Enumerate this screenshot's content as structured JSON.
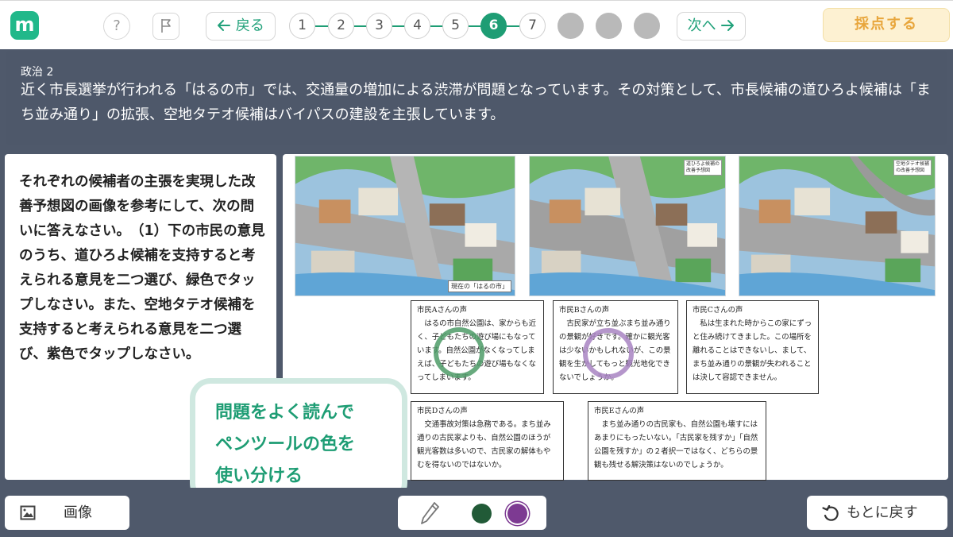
{
  "app": {
    "logo_letter": "m"
  },
  "toolbar": {
    "help_symbol": "?",
    "back_label": "戻る",
    "next_label": "次へ",
    "grade_label": "採点する",
    "steps": [
      "1",
      "2",
      "3",
      "4",
      "5",
      "6",
      "7",
      "",
      "",
      ""
    ],
    "current_step": "6"
  },
  "question": {
    "label": "政治 2",
    "text": "近く市長選挙が行われる「はるの市」では、交通量の増加による渋滞が問題となっています。その対策として、市長候補の道ひろよ候補は「まち並み通り」の拡張、空地タテオ候補はバイパスの建設を主張しています。"
  },
  "instructions": {
    "text": "それぞれの候補者の主張を実現した改善予想図の画像を参考にして、次の問いに答えなさい。　（1）下の市民の意見のうち、道ひろよ候補を支持すると考えられる意見を二つ選び、緑色でタップしなさい。また、空地タテオ候補を支持すると考えられる意見を二つ選び、紫色でタップしなさい。"
  },
  "images": {
    "current_caption": "現在の「はるの市」",
    "michi_badge": "道ひろよ候補の改善予想図",
    "sorachi_badge": "空地タテオ候補の改善予想図"
  },
  "opinions": [
    {
      "title": "市民Aさんの声",
      "body": "はるの市自然公園は、家からも近く、子どもたちの遊び場にもなっています。自然公園がなくなってしまえば、子どもたちの遊び場もなくなってしまいます。"
    },
    {
      "title": "市民Bさんの声",
      "body": "古民家が立ち並ぶまち並み通りの景観が好きです。確かに観光客は少ないかもしれないが、この景観を生かしてもっと観光地化できないでしょうか。"
    },
    {
      "title": "市民Cさんの声",
      "body": "私は生まれた時からこの家にずっと住み続けてきました。この場所を離れることはできないし、まして、まち並み通りの景観が失われることは決して容認できません。"
    },
    {
      "title": "市民Dさんの声",
      "body": "交通事故対策は急務である。まち並み通りの古民家よりも、自然公園のほうが観光客数は多いので、古民家の解体もやむを得ないのではないか。"
    },
    {
      "title": "市民Eさんの声",
      "body": "まち並み通りの古民家も、自然公園も壊すにはあまりにもったいない。「古民家を残すか」「自然公園を残すか」の２者択一ではなく、どちらの景観も残せる解決策はないのでしょうか。"
    }
  ],
  "tip": {
    "lines": [
      "問題をよく読んで",
      "ペンツールの色を",
      "使い分ける"
    ]
  },
  "bottom": {
    "image_label": "画像",
    "undo_label": "もとに戻す"
  },
  "colors": {
    "accent": "#1e9d74",
    "pen_green": "#215a37",
    "pen_purple": "#7d3a92",
    "mark_green": "#4e9b67",
    "mark_purple": "#a884c2"
  },
  "icons": [
    "help-icon",
    "flag-icon",
    "arrow-left-icon",
    "arrow-right-icon",
    "image-icon",
    "pen-icon",
    "undo-icon"
  ]
}
